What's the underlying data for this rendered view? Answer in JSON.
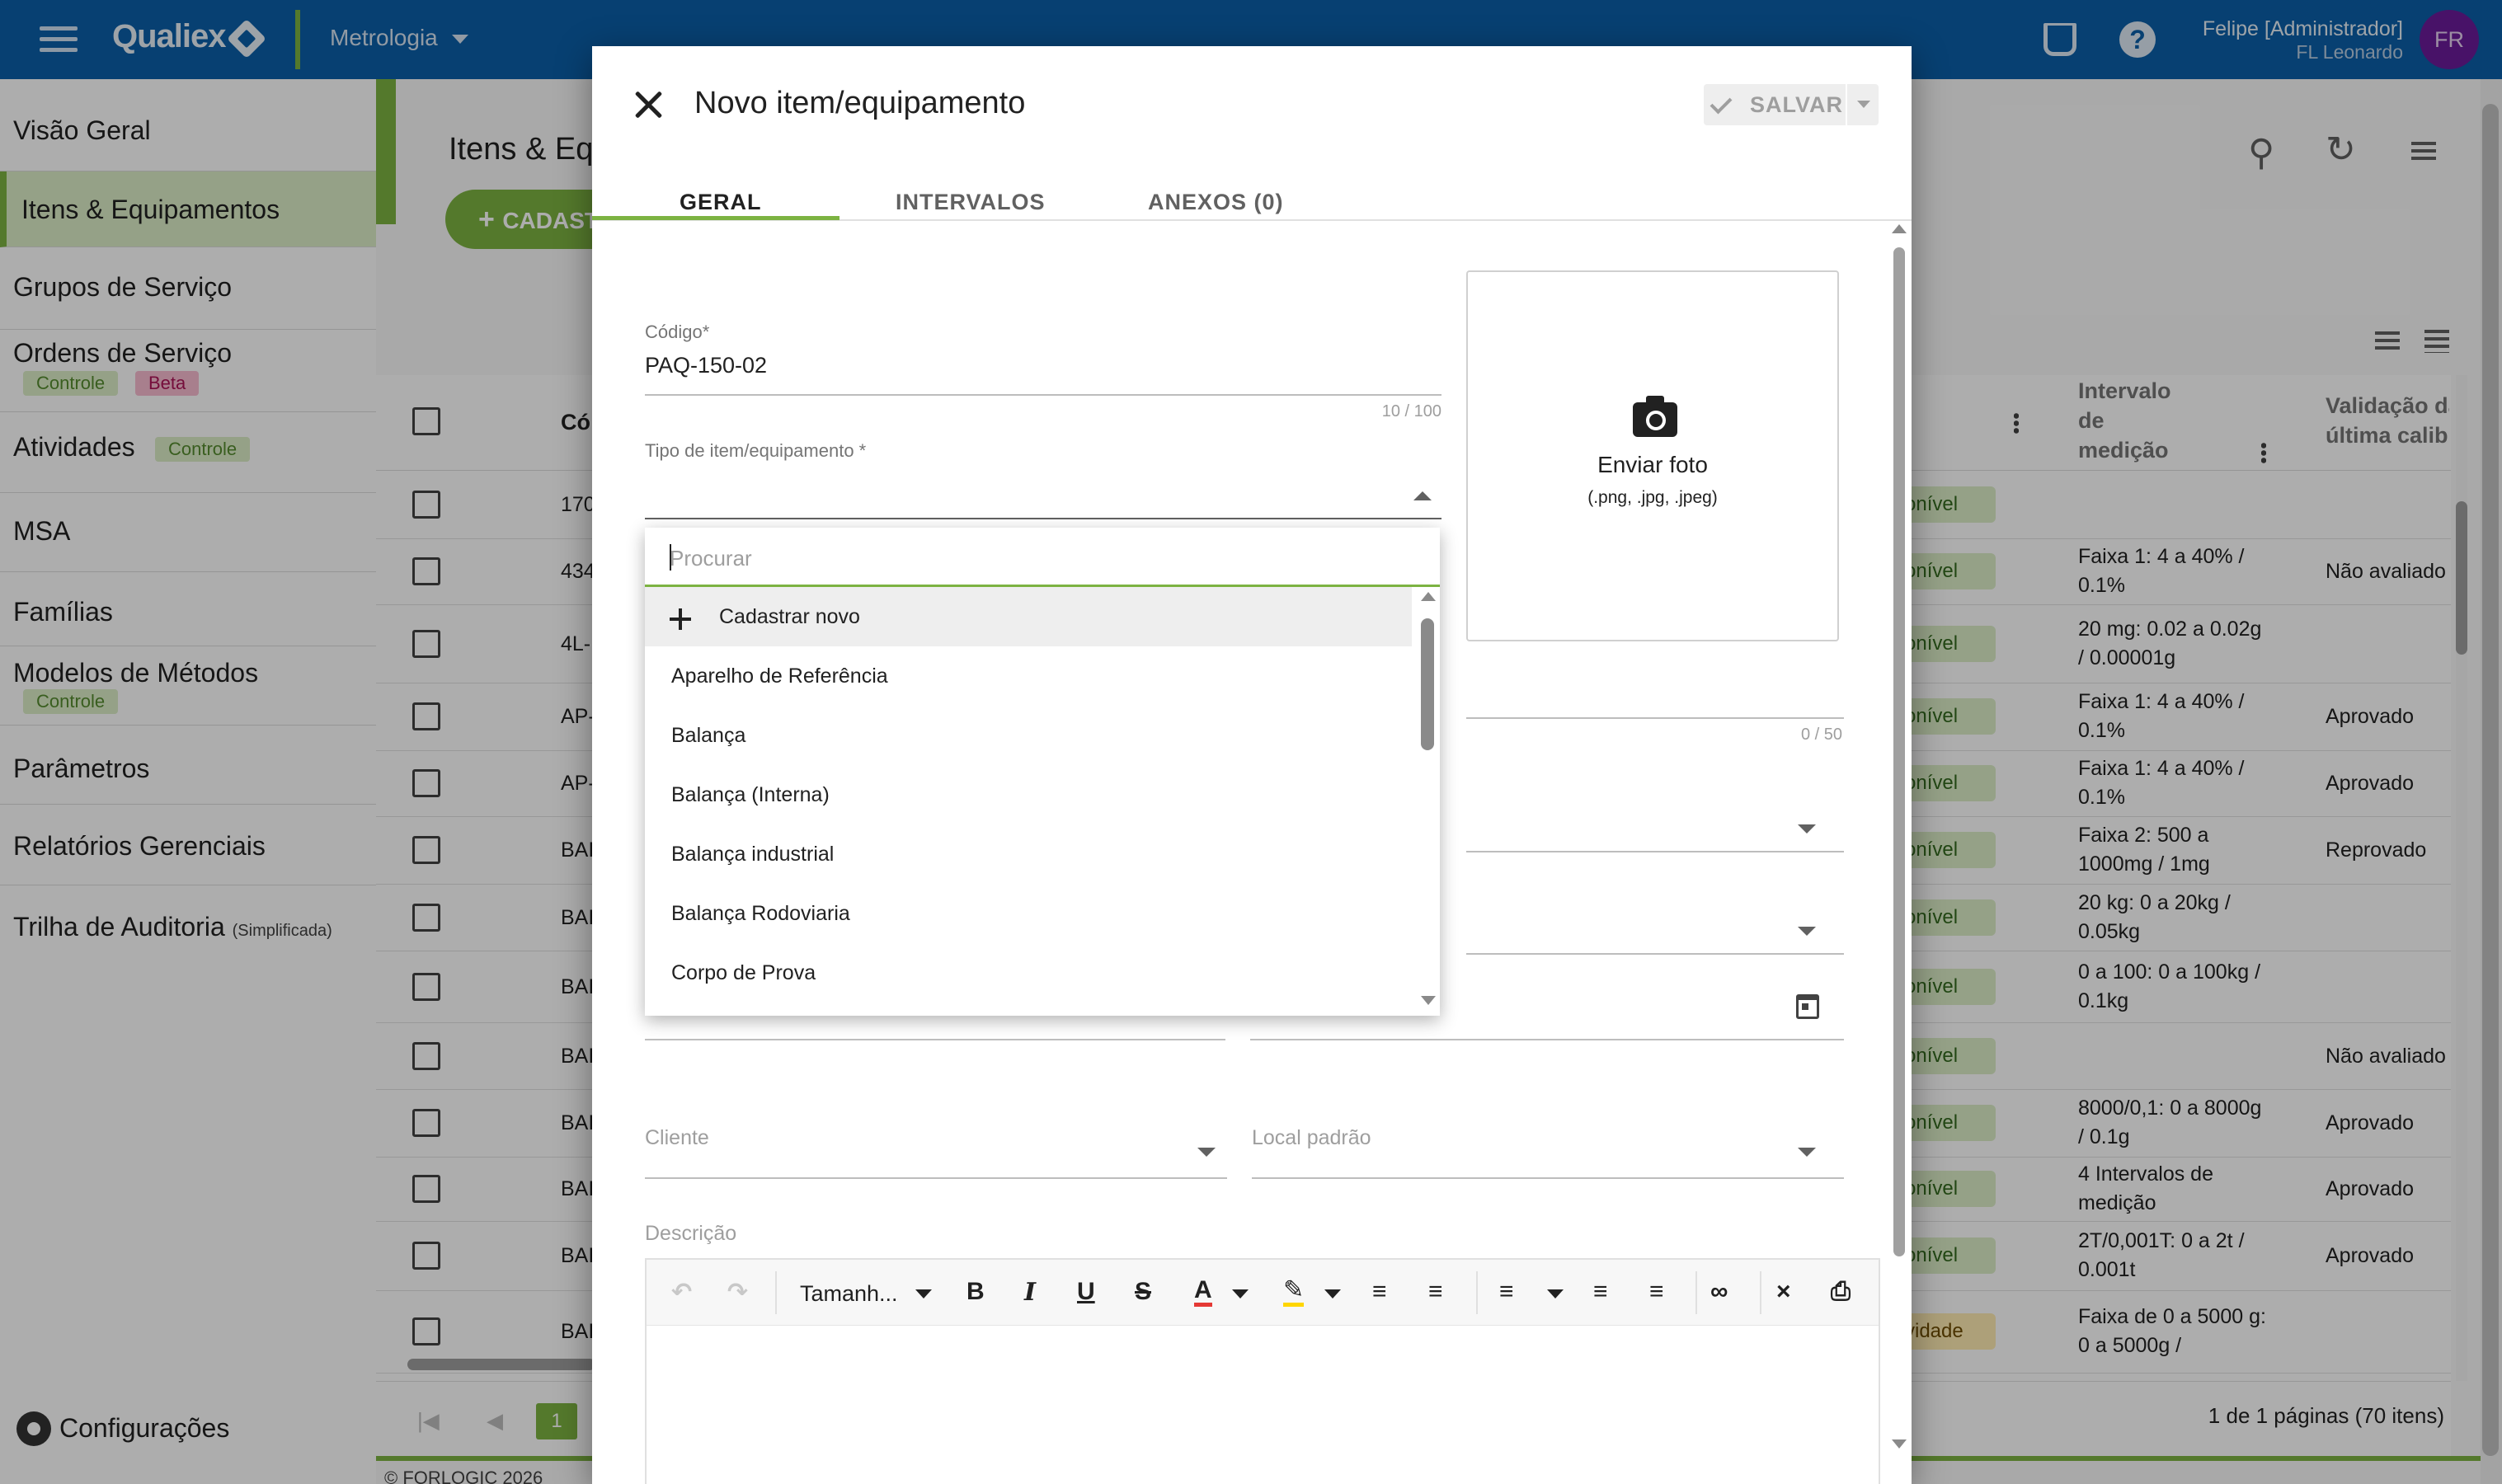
{
  "app": {
    "brand": "Qualiex",
    "module": "Metrologia",
    "user_name": "Felipe [Administrador]",
    "user_org": "FL Leonardo",
    "avatar_initials": "FR",
    "colors": {
      "appbar": "#0b5fa8",
      "accent": "#7cb342",
      "avatar": "#6a1b9a"
    }
  },
  "sidebar": {
    "items": [
      {
        "label": "Visão Geral"
      },
      {
        "label": "Itens & Equipamentos",
        "active": true
      },
      {
        "label": "Grupos de Serviço"
      },
      {
        "label": "Ordens de Serviço",
        "badges": [
          "Controle",
          "Beta"
        ]
      },
      {
        "label": "Atividades",
        "badges": [
          "Controle"
        ]
      },
      {
        "label": "MSA"
      },
      {
        "label": "Famílias"
      },
      {
        "label": "Modelos de Métodos",
        "badges": [
          "Controle"
        ]
      },
      {
        "label": "Parâmetros"
      },
      {
        "label": "Relatórios Gerenciais"
      },
      {
        "label": "Trilha de Auditoria",
        "suffix": "(Simplificada)"
      }
    ],
    "settings_label": "Configurações"
  },
  "page": {
    "title": "Itens & Eq",
    "add_button": "CADAST",
    "table": {
      "col_code_header": "Có",
      "col_interval_header": [
        "Intervalo",
        "de",
        "medição"
      ],
      "col_validation_header": [
        "Validação da",
        "última calibr"
      ],
      "rows": [
        {
          "code": "170",
          "status": "onível",
          "interval": "",
          "validation": ""
        },
        {
          "code": "434",
          "status": "onível",
          "interval": "Faixa 1: 4 a 40% / 0.1%",
          "validation": "Não avaliado"
        },
        {
          "code": "4L-",
          "status": "onível",
          "interval": "20 mg: 0.02 a 0.02g / 0.00001g",
          "validation": ""
        },
        {
          "code": "AP-",
          "status": "onível",
          "interval": "Faixa 1: 4 a 40% / 0.1%",
          "validation": "Aprovado"
        },
        {
          "code": "AP-",
          "status": "onível",
          "interval": "Faixa 1: 4 a 40% / 0.1%",
          "validation": "Aprovado"
        },
        {
          "code": "BAI",
          "status": "onível",
          "interval": "Faixa 2: 500 a 1000mg / 1mg",
          "validation": "Reprovado"
        },
        {
          "code": "BAI",
          "status": "onível",
          "interval": "20 kg: 0 a 20kg / 0.05kg",
          "validation": ""
        },
        {
          "code": "BAI",
          "status": "onível",
          "interval": "0 a 100: 0 a 100kg / 0.1kg",
          "validation": ""
        },
        {
          "code": "BAI",
          "status": "onível",
          "interval": "",
          "validation": "Não avaliado"
        },
        {
          "code": "BAI",
          "status": "onível",
          "interval": "8000/0,1: 0 a 8000g / 0.1g",
          "validation": "Aprovado"
        },
        {
          "code": "BAI",
          "status": "onível",
          "interval": "4 Intervalos de medição",
          "validation": "Aprovado"
        },
        {
          "code": "BAI",
          "status": "onível",
          "interval": "2T/0,001T: 0 a 2t / 0.001t",
          "validation": "Aprovado"
        },
        {
          "code": "BAI",
          "status": "vidade",
          "interval": "Faixa de 0 a 5000 g: 0 a 5000g /",
          "validation": ""
        }
      ]
    },
    "pagination": {
      "page": "1",
      "info": "1 de 1 páginas (70 itens)"
    },
    "copyright": "© FORLOGIC 2026"
  },
  "dialog": {
    "title": "Novo item/equipamento",
    "save_label": "SALVAR",
    "tabs": [
      {
        "label": "GERAL",
        "active": true
      },
      {
        "label": "INTERVALOS"
      },
      {
        "label": "ANEXOS (0)"
      }
    ],
    "code_field": {
      "label": "Código*",
      "value": "PAQ-150-02",
      "counter": "10 / 100"
    },
    "type_field": {
      "label": "Tipo de item/equipamento *"
    },
    "hidden_counter": "0 / 50",
    "photo": {
      "label": "Enviar foto",
      "types": "(.png, .jpg, .jpeg)"
    },
    "client_field": {
      "label": "Cliente"
    },
    "location_field": {
      "label": "Local padrão"
    },
    "description_label": "Descrição",
    "editor_size_label": "Tamanh..."
  },
  "dropdown": {
    "search_placeholder": "Procurar",
    "items": [
      {
        "label": "Cadastrar novo",
        "action": true
      },
      {
        "label": "Aparelho de Referência"
      },
      {
        "label": "Balança"
      },
      {
        "label": "Balança (Interna)"
      },
      {
        "label": "Balança industrial"
      },
      {
        "label": "Balança Rodoviaria"
      },
      {
        "label": "Corpo de Prova"
      }
    ]
  }
}
